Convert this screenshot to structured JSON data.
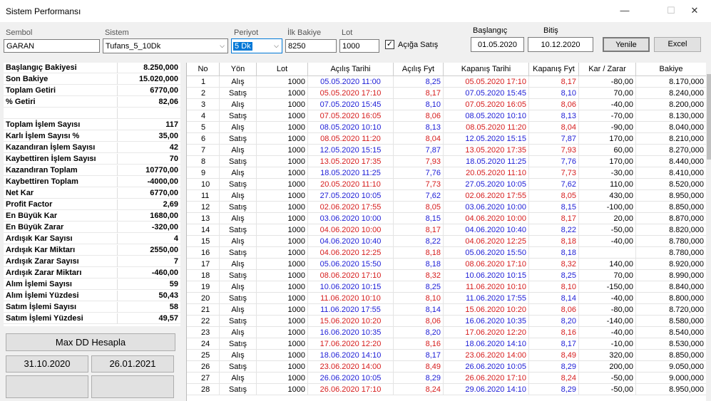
{
  "window": {
    "title": "Sistem Performansı",
    "minimize": "—",
    "maximize": "☐",
    "close": "✕"
  },
  "controls": {
    "sembol_label": "Sembol",
    "sembol_value": "GARAN",
    "sistem_label": "Sistem",
    "sistem_value": "Tufans_5_10Dk",
    "periyot_label": "Periyot",
    "periyot_value": "5 Dk",
    "bakiye_label": "İlk Bakiye",
    "bakiye_value": "8250",
    "lot_label": "Lot",
    "lot_value": "1000",
    "aciga_label": "Açığa Satış",
    "aciga_checked": "✓",
    "baslangic_label": "Başlangıç",
    "baslangic_value": "01.05.2020",
    "bitis_label": "Bitiş",
    "bitis_value": "10.12.2020",
    "yenile_label": "Yenile",
    "excel_label": "Excel"
  },
  "stats": [
    {
      "k": "Başlangıç Bakiyesi",
      "v": "8.250,000"
    },
    {
      "k": "Son Bakiye",
      "v": "15.020,000"
    },
    {
      "k": "Toplam Getiri",
      "v": "6770,00"
    },
    {
      "k": "% Getiri",
      "v": "82,06"
    },
    {
      "k": "",
      "v": ""
    },
    {
      "k": "Toplam İşlem Sayısı",
      "v": "117"
    },
    {
      "k": "Karlı İşlem Sayısı %",
      "v": "35,00"
    },
    {
      "k": "Kazandıran İşlem Sayısı",
      "v": "42"
    },
    {
      "k": "Kaybettiren İşlem Sayısı",
      "v": "70"
    },
    {
      "k": "Kazandıran Toplam",
      "v": "10770,00"
    },
    {
      "k": "Kaybettiren Toplam",
      "v": "-4000,00"
    },
    {
      "k": "Net Kar",
      "v": "6770,00"
    },
    {
      "k": "Profit Factor",
      "v": "2,69"
    },
    {
      "k": "En Büyük Kar",
      "v": "1680,00"
    },
    {
      "k": "En Büyük Zarar",
      "v": "-320,00"
    },
    {
      "k": "Ardışık Kar Sayısı",
      "v": "4"
    },
    {
      "k": "Ardışık Kar Miktarı",
      "v": "2550,00"
    },
    {
      "k": "Ardışık Zarar Sayısı",
      "v": "7"
    },
    {
      "k": "Ardışık Zarar Miktarı",
      "v": "-460,00"
    },
    {
      "k": "Alım İşlemi Sayısı",
      "v": "59"
    },
    {
      "k": "Alım İşlemi Yüzdesi",
      "v": "50,43"
    },
    {
      "k": "Satım İşlemi Sayısı",
      "v": "58"
    },
    {
      "k": "Satım İşlemi Yüzdesi",
      "v": "49,57"
    }
  ],
  "maxdd": {
    "button": "Max DD Hesapla",
    "date1": "31.10.2020",
    "date2": "26.01.2021",
    "blank1": "",
    "blank2": ""
  },
  "table": {
    "headers": [
      "No",
      "Yön",
      "Lot",
      "Açılış Tarihi",
      "Açılış Fyt",
      "Kapanış Tarihi",
      "Kapanış Fyt",
      "Kar / Zarar",
      "Bakiye"
    ],
    "colors": {
      "alis": "#1c1cd6",
      "satis": "#d61c1c"
    },
    "rows": [
      [
        "1",
        "Alış",
        "1000",
        "05.05.2020 11:00",
        "8,25",
        "05.05.2020 17:10",
        "8,17",
        "-80,00",
        "8.170,000"
      ],
      [
        "2",
        "Satış",
        "1000",
        "05.05.2020 17:10",
        "8,17",
        "07.05.2020 15:45",
        "8,10",
        "70,00",
        "8.240,000"
      ],
      [
        "3",
        "Alış",
        "1000",
        "07.05.2020 15:45",
        "8,10",
        "07.05.2020 16:05",
        "8,06",
        "-40,00",
        "8.200,000"
      ],
      [
        "4",
        "Satış",
        "1000",
        "07.05.2020 16:05",
        "8,06",
        "08.05.2020 10:10",
        "8,13",
        "-70,00",
        "8.130,000"
      ],
      [
        "5",
        "Alış",
        "1000",
        "08.05.2020 10:10",
        "8,13",
        "08.05.2020 11:20",
        "8,04",
        "-90,00",
        "8.040,000"
      ],
      [
        "6",
        "Satış",
        "1000",
        "08.05.2020 11:20",
        "8,04",
        "12.05.2020 15:15",
        "7,87",
        "170,00",
        "8.210,000"
      ],
      [
        "7",
        "Alış",
        "1000",
        "12.05.2020 15:15",
        "7,87",
        "13.05.2020 17:35",
        "7,93",
        "60,00",
        "8.270,000"
      ],
      [
        "8",
        "Satış",
        "1000",
        "13.05.2020 17:35",
        "7,93",
        "18.05.2020 11:25",
        "7,76",
        "170,00",
        "8.440,000"
      ],
      [
        "9",
        "Alış",
        "1000",
        "18.05.2020 11:25",
        "7,76",
        "20.05.2020 11:10",
        "7,73",
        "-30,00",
        "8.410,000"
      ],
      [
        "10",
        "Satış",
        "1000",
        "20.05.2020 11:10",
        "7,73",
        "27.05.2020 10:05",
        "7,62",
        "110,00",
        "8.520,000"
      ],
      [
        "11",
        "Alış",
        "1000",
        "27.05.2020 10:05",
        "7,62",
        "02.06.2020 17:55",
        "8,05",
        "430,00",
        "8.950,000"
      ],
      [
        "12",
        "Satış",
        "1000",
        "02.06.2020 17:55",
        "8,05",
        "03.06.2020 10:00",
        "8,15",
        "-100,00",
        "8.850,000"
      ],
      [
        "13",
        "Alış",
        "1000",
        "03.06.2020 10:00",
        "8,15",
        "04.06.2020 10:00",
        "8,17",
        "20,00",
        "8.870,000"
      ],
      [
        "14",
        "Satış",
        "1000",
        "04.06.2020 10:00",
        "8,17",
        "04.06.2020 10:40",
        "8,22",
        "-50,00",
        "8.820,000"
      ],
      [
        "15",
        "Alış",
        "1000",
        "04.06.2020 10:40",
        "8,22",
        "04.06.2020 12:25",
        "8,18",
        "-40,00",
        "8.780,000"
      ],
      [
        "16",
        "Satış",
        "1000",
        "04.06.2020 12:25",
        "8,18",
        "05.06.2020 15:50",
        "8,18",
        "",
        "8.780,000"
      ],
      [
        "17",
        "Alış",
        "1000",
        "05.06.2020 15:50",
        "8,18",
        "08.06.2020 17:10",
        "8,32",
        "140,00",
        "8.920,000"
      ],
      [
        "18",
        "Satış",
        "1000",
        "08.06.2020 17:10",
        "8,32",
        "10.06.2020 10:15",
        "8,25",
        "70,00",
        "8.990,000"
      ],
      [
        "19",
        "Alış",
        "1000",
        "10.06.2020 10:15",
        "8,25",
        "11.06.2020 10:10",
        "8,10",
        "-150,00",
        "8.840,000"
      ],
      [
        "20",
        "Satış",
        "1000",
        "11.06.2020 10:10",
        "8,10",
        "11.06.2020 17:55",
        "8,14",
        "-40,00",
        "8.800,000"
      ],
      [
        "21",
        "Alış",
        "1000",
        "11.06.2020 17:55",
        "8,14",
        "15.06.2020 10:20",
        "8,06",
        "-80,00",
        "8.720,000"
      ],
      [
        "22",
        "Satış",
        "1000",
        "15.06.2020 10:20",
        "8,06",
        "16.06.2020 10:35",
        "8,20",
        "-140,00",
        "8.580,000"
      ],
      [
        "23",
        "Alış",
        "1000",
        "16.06.2020 10:35",
        "8,20",
        "17.06.2020 12:20",
        "8,16",
        "-40,00",
        "8.540,000"
      ],
      [
        "24",
        "Satış",
        "1000",
        "17.06.2020 12:20",
        "8,16",
        "18.06.2020 14:10",
        "8,17",
        "-10,00",
        "8.530,000"
      ],
      [
        "25",
        "Alış",
        "1000",
        "18.06.2020 14:10",
        "8,17",
        "23.06.2020 14:00",
        "8,49",
        "320,00",
        "8.850,000"
      ],
      [
        "26",
        "Satış",
        "1000",
        "23.06.2020 14:00",
        "8,49",
        "26.06.2020 10:05",
        "8,29",
        "200,00",
        "9.050,000"
      ],
      [
        "27",
        "Alış",
        "1000",
        "26.06.2020 10:05",
        "8,29",
        "26.06.2020 17:10",
        "8,24",
        "-50,00",
        "9.000,000"
      ],
      [
        "28",
        "Satış",
        "1000",
        "26.06.2020 17:10",
        "8,24",
        "29.06.2020 14:10",
        "8,29",
        "-50,00",
        "8.950,000"
      ]
    ]
  }
}
